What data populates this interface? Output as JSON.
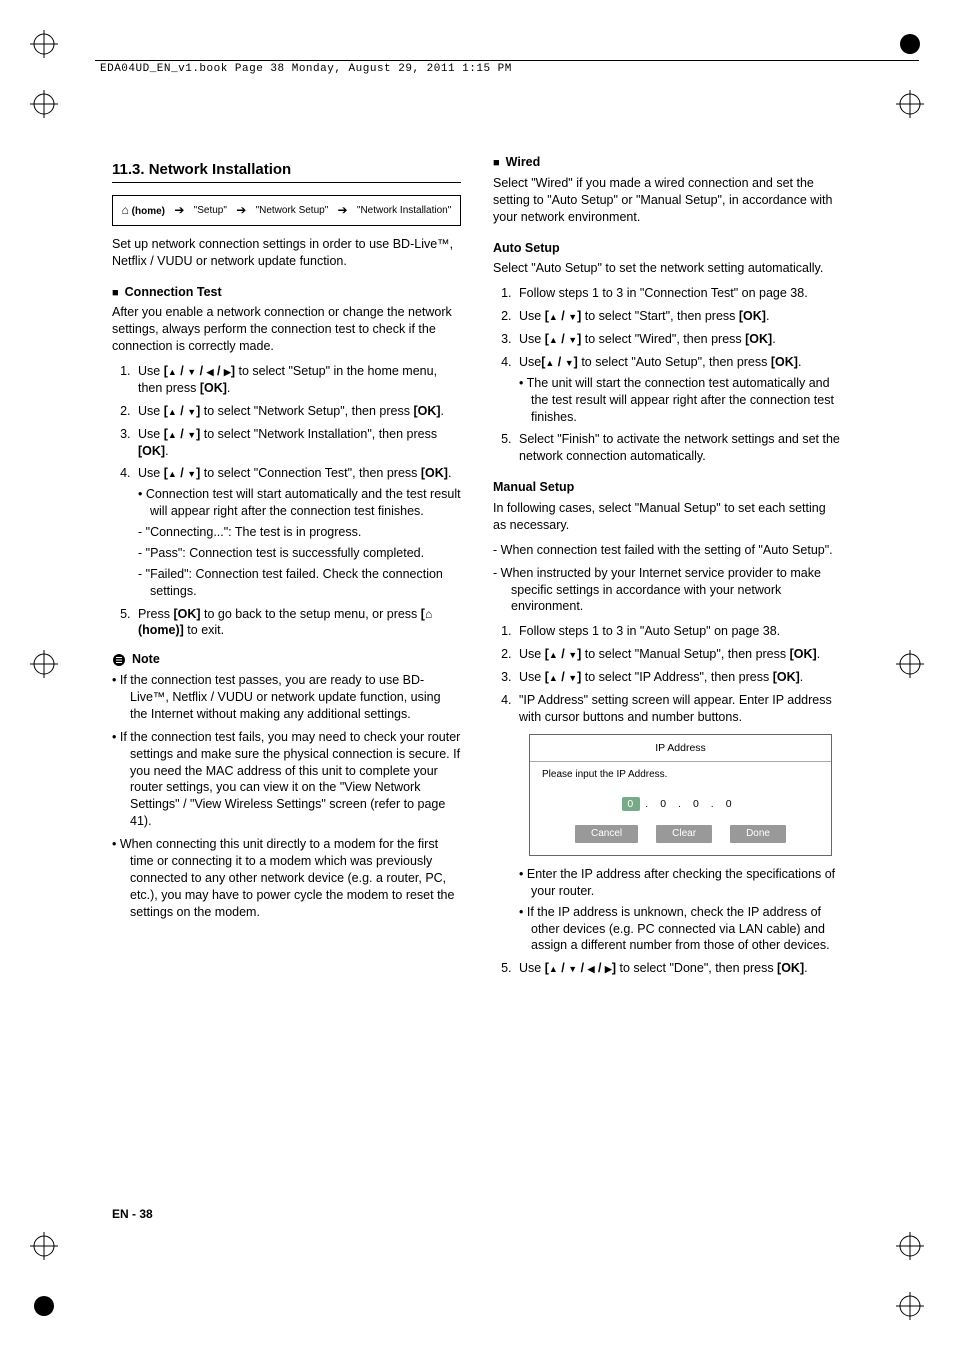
{
  "header_running": "EDA04UD_EN_v1.book  Page 38  Monday, August 29, 2011  1:15 PM",
  "left": {
    "section_title": "11.3.  Network Installation",
    "breadcrumb": [
      "⌂ (home)",
      "\"Setup\"",
      "\"Network Setup\"",
      "\"Network Installation\""
    ],
    "intro": "Set up network connection settings in order to use BD-Live™, Netflix / VUDU or network update function.",
    "conn_test_heading": "Connection Test",
    "conn_test_intro": "After you enable a network connection or change the network settings, always perform the connection test to check if the connection is correctly made.",
    "steps": [
      "Use [▲ / ▼ / ◀ / ▶] to select \"Setup\" in the home menu, then press [OK].",
      "Use [▲ / ▼] to select \"Network Setup\", then press [OK].",
      "Use [▲ / ▼] to select \"Network Installation\", then press [OK].",
      "Use [▲ / ▼] to select \"Connection Test\", then press [OK].",
      "Press [OK] to go back to the setup menu, or press [⌂ (home)] to exit."
    ],
    "step4_subs": [
      "Connection test will start automatically and the test result will appear right after the connection test finishes.",
      "\"Connecting...\": The test is in progress.",
      "\"Pass\": Connection test is successfully completed.",
      "\"Failed\": Connection test failed. Check the connection settings."
    ],
    "note_label": "Note",
    "notes": [
      "If the connection test passes, you are ready to use BD-Live™, Netflix / VUDU or network update function, using the Internet without making any additional settings.",
      "If the connection test fails, you may need to check your router settings and make sure the physical connection is secure. If you need the MAC address of this unit to complete your router settings, you can view it on the \"View Network Settings\" / \"View Wireless Settings\" screen (refer to page 41).",
      "When connecting this unit directly to a modem for the first time or connecting it to a modem which was previously connected to any other network device (e.g. a router, PC, etc.), you may have to power cycle the modem to reset the settings on the modem."
    ]
  },
  "right": {
    "wired_heading": "Wired",
    "wired_intro": "Select \"Wired\" if you made a wired connection and set the setting to \"Auto Setup\" or \"Manual Setup\", in accordance with your network environment.",
    "auto_heading": "Auto Setup",
    "auto_intro": "Select \"Auto Setup\" to set the network setting automatically.",
    "auto_steps": [
      "Follow steps 1 to 3 in \"Connection Test\" on page 38.",
      "Use [▲ / ▼] to select \"Start\", then press [OK].",
      "Use [▲ / ▼] to select \"Wired\", then press [OK].",
      "Use[▲ / ▼] to select \"Auto Setup\", then press [OK].",
      "Select \"Finish\" to activate the network settings and set the network connection automatically."
    ],
    "auto_step4_sub": "The unit will start the connection test automatically and the test result will appear right after the connection test finishes.",
    "manual_heading": "Manual Setup",
    "manual_intro": "In following cases, select \"Manual Setup\" to set each setting as necessary.",
    "manual_cases": [
      "When connection test failed with the setting of \"Auto Setup\".",
      "When instructed by your Internet service provider to make specific settings in accordance with your network environment."
    ],
    "manual_steps_a": [
      "Follow steps 1 to 3 in \"Auto Setup\" on page 38.",
      "Use [▲ / ▼] to select \"Manual Setup\", then press [OK].",
      "Use [▲ / ▼] to select \"IP Address\", then press [OK].",
      "\"IP Address\" setting screen will appear. Enter IP address with cursor buttons and number buttons."
    ],
    "ip_box": {
      "title": "IP Address",
      "prompt": "Please input the IP Address.",
      "digits": [
        "0",
        "0",
        "0",
        "0"
      ],
      "buttons": [
        "Cancel",
        "Clear",
        "Done"
      ]
    },
    "manual_step4_subs": [
      "Enter the IP address after checking the specifications of your router.",
      "If the IP address is unknown, check the IP address of other devices (e.g. PC connected via LAN cable) and assign a different number from those of other devices."
    ],
    "manual_step5": "Use [▲ / ▼ / ◀ / ▶] to select \"Done\", then press [OK]."
  },
  "footer": "EN - 38"
}
